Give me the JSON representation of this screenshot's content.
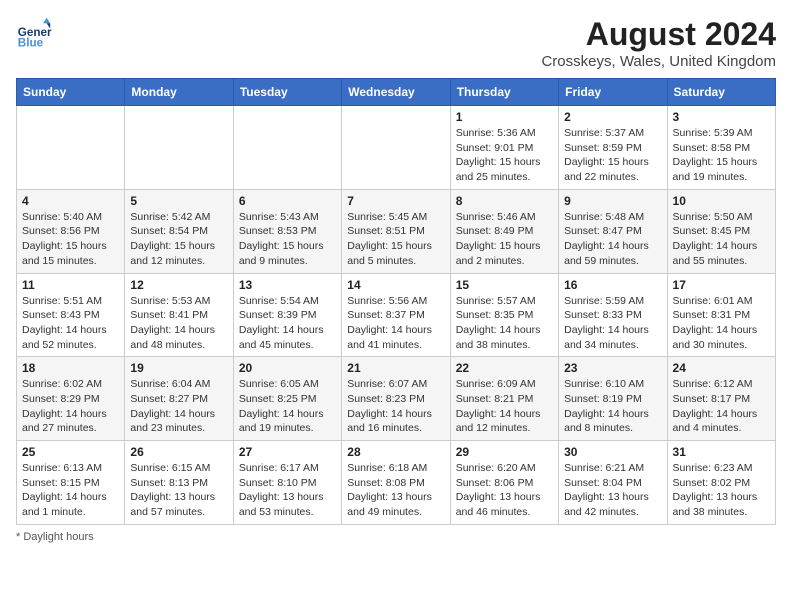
{
  "header": {
    "logo_text_general": "General",
    "logo_text_blue": "Blue",
    "title": "August 2024",
    "subtitle": "Crosskeys, Wales, United Kingdom"
  },
  "days_of_week": [
    "Sunday",
    "Monday",
    "Tuesday",
    "Wednesday",
    "Thursday",
    "Friday",
    "Saturday"
  ],
  "weeks": [
    [
      {
        "day": "",
        "info": ""
      },
      {
        "day": "",
        "info": ""
      },
      {
        "day": "",
        "info": ""
      },
      {
        "day": "",
        "info": ""
      },
      {
        "day": "1",
        "info": "Sunrise: 5:36 AM\nSunset: 9:01 PM\nDaylight: 15 hours and 25 minutes."
      },
      {
        "day": "2",
        "info": "Sunrise: 5:37 AM\nSunset: 8:59 PM\nDaylight: 15 hours and 22 minutes."
      },
      {
        "day": "3",
        "info": "Sunrise: 5:39 AM\nSunset: 8:58 PM\nDaylight: 15 hours and 19 minutes."
      }
    ],
    [
      {
        "day": "4",
        "info": "Sunrise: 5:40 AM\nSunset: 8:56 PM\nDaylight: 15 hours and 15 minutes."
      },
      {
        "day": "5",
        "info": "Sunrise: 5:42 AM\nSunset: 8:54 PM\nDaylight: 15 hours and 12 minutes."
      },
      {
        "day": "6",
        "info": "Sunrise: 5:43 AM\nSunset: 8:53 PM\nDaylight: 15 hours and 9 minutes."
      },
      {
        "day": "7",
        "info": "Sunrise: 5:45 AM\nSunset: 8:51 PM\nDaylight: 15 hours and 5 minutes."
      },
      {
        "day": "8",
        "info": "Sunrise: 5:46 AM\nSunset: 8:49 PM\nDaylight: 15 hours and 2 minutes."
      },
      {
        "day": "9",
        "info": "Sunrise: 5:48 AM\nSunset: 8:47 PM\nDaylight: 14 hours and 59 minutes."
      },
      {
        "day": "10",
        "info": "Sunrise: 5:50 AM\nSunset: 8:45 PM\nDaylight: 14 hours and 55 minutes."
      }
    ],
    [
      {
        "day": "11",
        "info": "Sunrise: 5:51 AM\nSunset: 8:43 PM\nDaylight: 14 hours and 52 minutes."
      },
      {
        "day": "12",
        "info": "Sunrise: 5:53 AM\nSunset: 8:41 PM\nDaylight: 14 hours and 48 minutes."
      },
      {
        "day": "13",
        "info": "Sunrise: 5:54 AM\nSunset: 8:39 PM\nDaylight: 14 hours and 45 minutes."
      },
      {
        "day": "14",
        "info": "Sunrise: 5:56 AM\nSunset: 8:37 PM\nDaylight: 14 hours and 41 minutes."
      },
      {
        "day": "15",
        "info": "Sunrise: 5:57 AM\nSunset: 8:35 PM\nDaylight: 14 hours and 38 minutes."
      },
      {
        "day": "16",
        "info": "Sunrise: 5:59 AM\nSunset: 8:33 PM\nDaylight: 14 hours and 34 minutes."
      },
      {
        "day": "17",
        "info": "Sunrise: 6:01 AM\nSunset: 8:31 PM\nDaylight: 14 hours and 30 minutes."
      }
    ],
    [
      {
        "day": "18",
        "info": "Sunrise: 6:02 AM\nSunset: 8:29 PM\nDaylight: 14 hours and 27 minutes."
      },
      {
        "day": "19",
        "info": "Sunrise: 6:04 AM\nSunset: 8:27 PM\nDaylight: 14 hours and 23 minutes."
      },
      {
        "day": "20",
        "info": "Sunrise: 6:05 AM\nSunset: 8:25 PM\nDaylight: 14 hours and 19 minutes."
      },
      {
        "day": "21",
        "info": "Sunrise: 6:07 AM\nSunset: 8:23 PM\nDaylight: 14 hours and 16 minutes."
      },
      {
        "day": "22",
        "info": "Sunrise: 6:09 AM\nSunset: 8:21 PM\nDaylight: 14 hours and 12 minutes."
      },
      {
        "day": "23",
        "info": "Sunrise: 6:10 AM\nSunset: 8:19 PM\nDaylight: 14 hours and 8 minutes."
      },
      {
        "day": "24",
        "info": "Sunrise: 6:12 AM\nSunset: 8:17 PM\nDaylight: 14 hours and 4 minutes."
      }
    ],
    [
      {
        "day": "25",
        "info": "Sunrise: 6:13 AM\nSunset: 8:15 PM\nDaylight: 14 hours and 1 minute."
      },
      {
        "day": "26",
        "info": "Sunrise: 6:15 AM\nSunset: 8:13 PM\nDaylight: 13 hours and 57 minutes."
      },
      {
        "day": "27",
        "info": "Sunrise: 6:17 AM\nSunset: 8:10 PM\nDaylight: 13 hours and 53 minutes."
      },
      {
        "day": "28",
        "info": "Sunrise: 6:18 AM\nSunset: 8:08 PM\nDaylight: 13 hours and 49 minutes."
      },
      {
        "day": "29",
        "info": "Sunrise: 6:20 AM\nSunset: 8:06 PM\nDaylight: 13 hours and 46 minutes."
      },
      {
        "day": "30",
        "info": "Sunrise: 6:21 AM\nSunset: 8:04 PM\nDaylight: 13 hours and 42 minutes."
      },
      {
        "day": "31",
        "info": "Sunrise: 6:23 AM\nSunset: 8:02 PM\nDaylight: 13 hours and 38 minutes."
      }
    ]
  ],
  "footer": {
    "note": "Daylight hours"
  }
}
